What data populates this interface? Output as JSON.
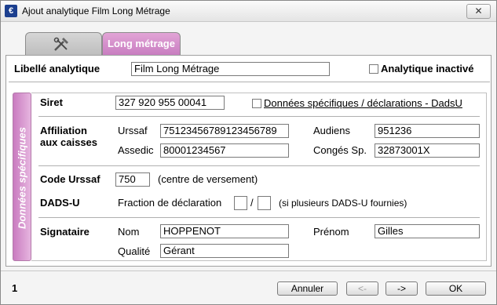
{
  "window": {
    "title": "Ajout analytique Film Long Métrage",
    "close_label": "✕"
  },
  "tabs": [
    {
      "label": "",
      "icon": "tools-icon"
    },
    {
      "label": "Long métrage"
    }
  ],
  "header": {
    "libelle_label": "Libellé analytique",
    "libelle_value": "Film Long Métrage",
    "inactive_label": "Analytique inactivé",
    "inactive_checked": false
  },
  "side_label": "Données spécifiques",
  "siret": {
    "label": "Siret",
    "value": "327 920 955 00041",
    "dadsu_label": "Données spécifiques / déclarations - DadsU",
    "dadsu_checked": false
  },
  "affiliation": {
    "label_line1": "Affiliation",
    "label_line2": "aux caisses",
    "urssaf_label": "Urssaf",
    "urssaf_value": "75123456789123456789",
    "assedic_label": "Assedic",
    "assedic_value": "80001234567",
    "audiens_label": "Audiens",
    "audiens_value": "951236",
    "conges_label": "Congés Sp.",
    "conges_value": "32873001X"
  },
  "code_urssaf": {
    "label": "Code Urssaf",
    "value": "750",
    "hint": "(centre de versement)"
  },
  "dadsu": {
    "label": "DADS-U",
    "fraction_label": "Fraction de déclaration",
    "fraction_num": "",
    "separator": "/",
    "fraction_den": "",
    "hint": "(si plusieurs DADS-U fournies)"
  },
  "signataire": {
    "label": "Signataire",
    "nom_label": "Nom",
    "nom_value": "HOPPENOT",
    "prenom_label": "Prénom",
    "prenom_value": "Gilles",
    "qualite_label": "Qualité",
    "qualite_value": "Gérant"
  },
  "footer": {
    "page_number": "1",
    "cancel_label": "Annuler",
    "prev_label": "<-",
    "next_label": "->",
    "ok_label": "OK"
  }
}
